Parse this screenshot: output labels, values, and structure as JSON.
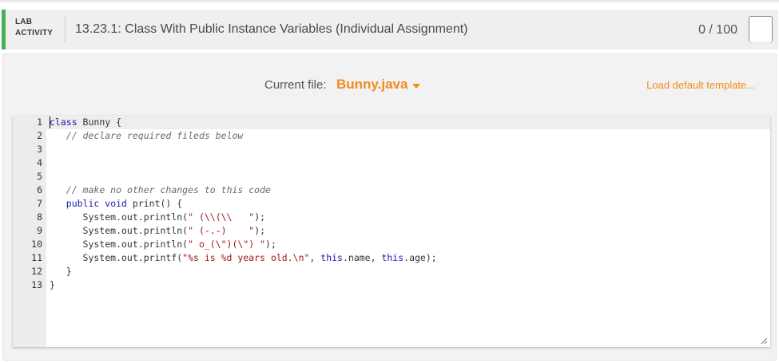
{
  "header": {
    "lab_line1": "LAB",
    "lab_line2": "ACTIVITY",
    "title": "13.23.1: Class With Public Instance Variables (Individual Assignment)",
    "score": "0 / 100"
  },
  "file_bar": {
    "current_file_label": "Current file:",
    "file_name": "Bunny.java",
    "load_default": "Load default template..."
  },
  "colors": {
    "accent": "#f28c1b",
    "lab_bar": "#4caf50"
  },
  "editor": {
    "line_numbers": [
      "1",
      "2",
      "3",
      "4",
      "5",
      "6",
      "7",
      "8",
      "9",
      "10",
      "11",
      "12",
      "13"
    ],
    "lines": [
      "class Bunny {",
      "   // declare required fileds below",
      "",
      "",
      "",
      "   // make no other changes to this code",
      "   public void print() {",
      "      System.out.println(\" (\\\\(\\\\   \");",
      "      System.out.println(\" (-.-)    \");",
      "      System.out.println(\" o_(\\\")(\\\") \");",
      "      System.out.printf(\"%s is %d years old.\\n\", this.name, this.age);",
      "   }",
      "}"
    ]
  }
}
